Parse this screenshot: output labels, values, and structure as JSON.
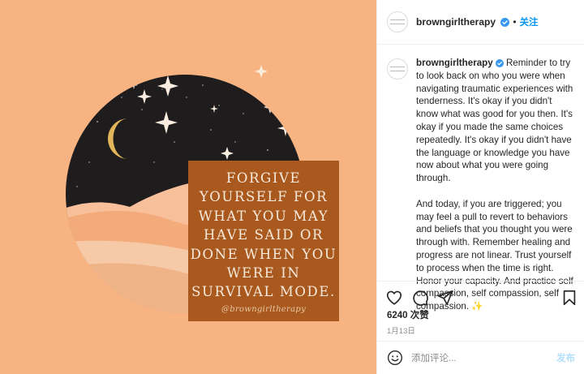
{
  "post": {
    "quote_lines": [
      "FORGIVE",
      "YOURSELF FOR",
      "WHAT YOU MAY",
      "HAVE SAID OR",
      "DONE WHEN YOU",
      "WERE IN",
      "SURVIVAL MODE."
    ],
    "quote_handle": "@browngirltherapy"
  },
  "header": {
    "username": "browngirltherapy",
    "separator": "•",
    "follow_label": "关注"
  },
  "caption": {
    "username": "browngirltherapy",
    "paragraph1": "Reminder to try to look back on who you were when navigating traumatic experiences with tenderness. It's okay if you didn't know what was good for you then. It's okay if you made the same choices repeatedly. It's okay if you didn't have the language or knowledge you have now about what you were going through.",
    "paragraph2": "And today, if you are triggered; you may feel a pull to revert to behaviors and beliefs that you thought you were through with. Remember healing and progress are not linear. Trust yourself to process when the time is right. Honor your capacity. And practice self compassion, self compassion, self compassion. ✨"
  },
  "stats": {
    "likes": "6240 次赞",
    "date": "1月13日"
  },
  "comment": {
    "placeholder": "添加评论...",
    "post_label": "发布"
  },
  "icons": {
    "like": "heart-icon",
    "comment": "comment-icon",
    "share": "send-icon",
    "save": "bookmark-icon",
    "emoji": "emoji-icon",
    "verified": "verified-badge-icon"
  },
  "colors": {
    "background": "#f7b482",
    "night_sky": "#1e1c1c",
    "quote_box": "#a9581e",
    "accent_blue": "#0095f6",
    "moon": "#e2b55a"
  }
}
